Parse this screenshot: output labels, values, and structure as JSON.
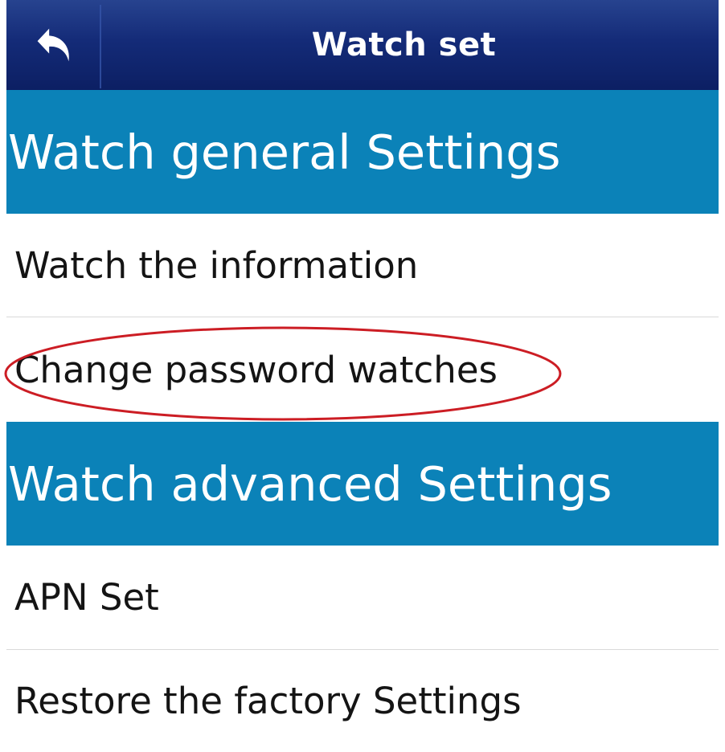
{
  "header": {
    "title": "Watch set",
    "back_icon": "back-arrow-icon"
  },
  "sections": {
    "general": {
      "title": "Watch general Settings",
      "items": [
        {
          "label": "Watch the information"
        },
        {
          "label": "Change password watches",
          "highlighted": true
        }
      ]
    },
    "advanced": {
      "title": "Watch advanced Settings",
      "items": [
        {
          "label": "APN Set"
        },
        {
          "label": "Restore the factory Settings"
        }
      ]
    }
  },
  "colors": {
    "header_dark_blue": "#142b78",
    "section_blue": "#0b82b8",
    "annotation_red": "#cc1d24",
    "text_dark": "#141414",
    "divider": "#dadada"
  }
}
